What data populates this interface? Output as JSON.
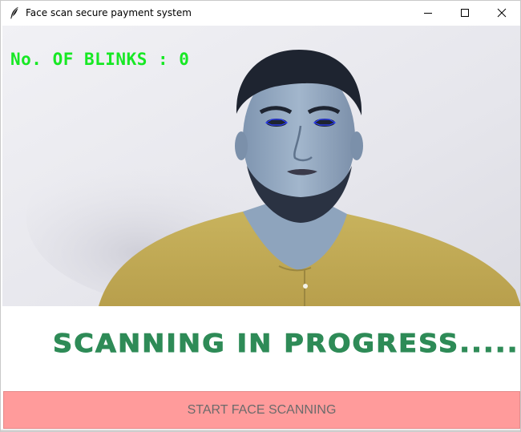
{
  "window": {
    "title": "Face scan secure payment system",
    "controls": [
      "minimize-icon",
      "maximize-icon",
      "close-icon"
    ]
  },
  "video": {
    "blink_counter": "No. OF BLINKS : 0"
  },
  "status": {
    "message": "SCANNING IN PROGRESS.........."
  },
  "actions": {
    "start_label": "START FACE SCANNING"
  },
  "colors": {
    "blink_text": "#17e824",
    "status_text": "#2e8b57",
    "button_bg": "#ff9b9b",
    "button_text": "#6b6b6b"
  }
}
